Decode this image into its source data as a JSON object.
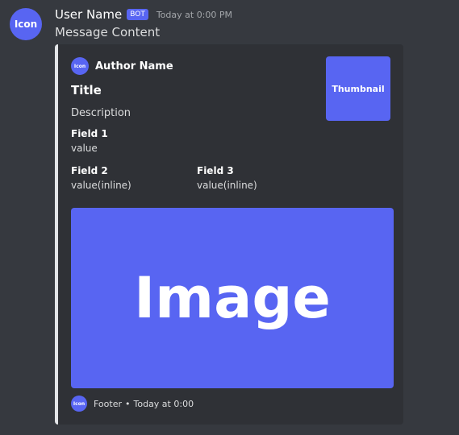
{
  "message": {
    "avatar_text": "Icon",
    "username": "User Name",
    "bot_badge": "BOT",
    "timestamp": "Today at 0:00 PM",
    "content": "Message Content"
  },
  "embed": {
    "accent_color": "#e3e5e8",
    "author": {
      "icon_text": "Icon",
      "name": "Author Name"
    },
    "thumbnail_text": "Thumbnail",
    "title": "Title",
    "description": "Description",
    "fields": [
      {
        "name": "Field 1",
        "value": "value"
      },
      {
        "name": "Field 2",
        "value": "value(inline)"
      },
      {
        "name": "Field 3",
        "value": "value(inline)"
      }
    ],
    "image_text": "Image",
    "footer": {
      "icon_text": "Icon",
      "text": "Footer",
      "separator": "•",
      "timestamp": "Today at 0:00"
    }
  },
  "colors": {
    "background": "#36393f",
    "embed_background": "#2f3136",
    "blurple": "#5865f2"
  }
}
